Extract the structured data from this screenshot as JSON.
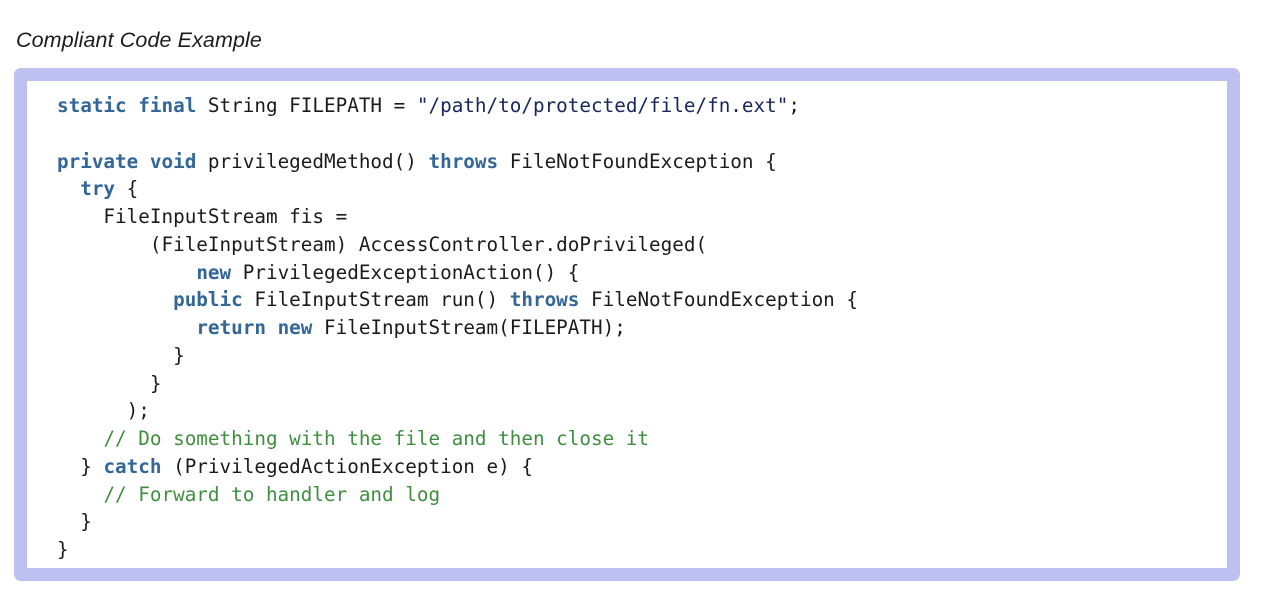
{
  "page": {
    "title": "Compliant Code Example",
    "background_color": "#ffffff"
  },
  "code_card": {
    "border_color": "#bcc1f2",
    "background_color": "#ffffff",
    "language": "java"
  },
  "syntax_colors": {
    "keyword": "#336699",
    "string": "#17255c",
    "comment": "#3f8f3f",
    "plain": "#1b1b1b"
  },
  "code": {
    "full_text": "static final String FILEPATH = \"/path/to/protected/file/fn.ext\";\n\nprivate void privilegedMethod() throws FileNotFoundException {\n  try {\n    FileInputStream fis =\n        (FileInputStream) AccessController.doPrivileged(\n            new PrivilegedExceptionAction() {\n          public FileInputStream run() throws FileNotFoundException {\n            return new FileInputStream(FILEPATH);\n          }\n        }\n      );\n    // Do something with the file and then close it\n  } catch (PrivilegedActionException e) {\n    // Forward to handler and log\n  }\n}",
    "lines": [
      {
        "n": 1,
        "tokens": [
          {
            "t": "static",
            "k": "kw"
          },
          {
            "t": " ",
            "k": "pln"
          },
          {
            "t": "final",
            "k": "kw"
          },
          {
            "t": " String FILEPATH = ",
            "k": "pln"
          },
          {
            "t": "\"/path/to/protected/file/fn.ext\"",
            "k": "str"
          },
          {
            "t": ";",
            "k": "pln"
          }
        ]
      },
      {
        "n": 2,
        "tokens": []
      },
      {
        "n": 3,
        "tokens": [
          {
            "t": "private",
            "k": "kw"
          },
          {
            "t": " ",
            "k": "pln"
          },
          {
            "t": "void",
            "k": "kw"
          },
          {
            "t": " privilegedMethod() ",
            "k": "pln"
          },
          {
            "t": "throws",
            "k": "kw"
          },
          {
            "t": " FileNotFoundException {",
            "k": "pln"
          }
        ]
      },
      {
        "n": 4,
        "tokens": [
          {
            "t": "  ",
            "k": "pln"
          },
          {
            "t": "try",
            "k": "kw"
          },
          {
            "t": " {",
            "k": "pln"
          }
        ]
      },
      {
        "n": 5,
        "tokens": [
          {
            "t": "    FileInputStream fis =",
            "k": "pln"
          }
        ]
      },
      {
        "n": 6,
        "tokens": [
          {
            "t": "        (FileInputStream) AccessController.doPrivileged(",
            "k": "pln"
          }
        ]
      },
      {
        "n": 7,
        "tokens": [
          {
            "t": "            ",
            "k": "pln"
          },
          {
            "t": "new",
            "k": "kw"
          },
          {
            "t": " PrivilegedExceptionAction() {",
            "k": "pln"
          }
        ]
      },
      {
        "n": 8,
        "tokens": [
          {
            "t": "          ",
            "k": "pln"
          },
          {
            "t": "public",
            "k": "kw"
          },
          {
            "t": " FileInputStream run() ",
            "k": "pln"
          },
          {
            "t": "throws",
            "k": "kw"
          },
          {
            "t": " FileNotFoundException {",
            "k": "pln"
          }
        ]
      },
      {
        "n": 9,
        "tokens": [
          {
            "t": "            ",
            "k": "pln"
          },
          {
            "t": "return",
            "k": "kw"
          },
          {
            "t": " ",
            "k": "pln"
          },
          {
            "t": "new",
            "k": "kw"
          },
          {
            "t": " FileInputStream(FILEPATH);",
            "k": "pln"
          }
        ]
      },
      {
        "n": 10,
        "tokens": [
          {
            "t": "          }",
            "k": "pln"
          }
        ]
      },
      {
        "n": 11,
        "tokens": [
          {
            "t": "        }",
            "k": "pln"
          }
        ]
      },
      {
        "n": 12,
        "tokens": [
          {
            "t": "      );",
            "k": "pln"
          }
        ]
      },
      {
        "n": 13,
        "tokens": [
          {
            "t": "    ",
            "k": "pln"
          },
          {
            "t": "// Do something with the file and then close it",
            "k": "com"
          }
        ]
      },
      {
        "n": 14,
        "tokens": [
          {
            "t": "  } ",
            "k": "pln"
          },
          {
            "t": "catch",
            "k": "kw"
          },
          {
            "t": " (PrivilegedActionException e) {",
            "k": "pln"
          }
        ]
      },
      {
        "n": 15,
        "tokens": [
          {
            "t": "    ",
            "k": "pln"
          },
          {
            "t": "// Forward to handler and log",
            "k": "com"
          }
        ]
      },
      {
        "n": 16,
        "tokens": [
          {
            "t": "  }",
            "k": "pln"
          }
        ]
      },
      {
        "n": 17,
        "tokens": [
          {
            "t": "}",
            "k": "pln"
          }
        ]
      }
    ]
  }
}
